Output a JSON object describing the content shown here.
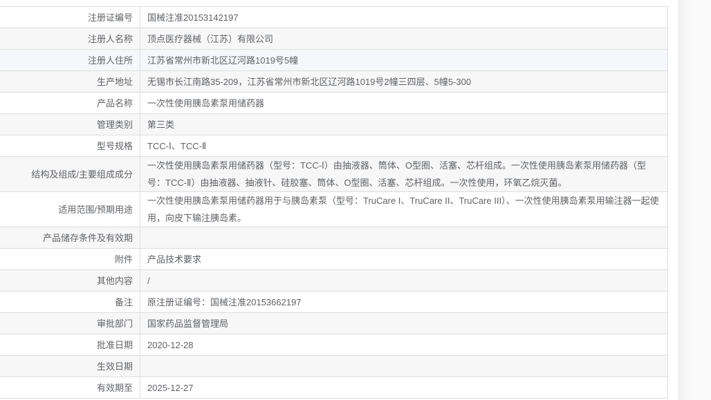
{
  "rows": [
    {
      "label": "注册证编号",
      "value": "国械注准20153142197"
    },
    {
      "label": "注册人名称",
      "value": "顶点医疗器械（江苏）有限公司"
    },
    {
      "label": "注册人住所",
      "value": "江苏省常州市新北区辽河路1019号5幢"
    },
    {
      "label": "生产地址",
      "value": "无锡市长江南路35-209，江苏省常州市新北区辽河路1019号2幢三四层、5幢5-300"
    },
    {
      "label": "产品名称",
      "value": "一次性使用胰岛素泵用储药器"
    },
    {
      "label": "管理类别",
      "value": "第三类"
    },
    {
      "label": "型号规格",
      "value": "TCC-Ⅰ、TCC-Ⅱ"
    },
    {
      "label": "结构及组成/主要组成成分",
      "value": "一次性使用胰岛素泵用储药器（型号：TCC-Ⅰ）由抽液器、筒体、O型圈、活塞、芯杆组成。一次性使用胰岛素泵用储药器（型号：TCC-Ⅱ）由抽液器、抽液针、硅胶塞、筒体、O型圈、活塞、芯杆组成。一次性使用，环氧乙烷灭菌。"
    },
    {
      "label": "适用范围/预期用途",
      "value": "一次性使用胰岛素泵用储药器用于与胰岛素泵（型号：TruCare I、TruCare II、TruCare III）、一次性使用胰岛素泵用输注器一起使用，向皮下输注胰岛素。"
    },
    {
      "label": "产品储存条件及有效期",
      "value": ""
    },
    {
      "label": "附件",
      "value": "产品技术要求"
    },
    {
      "label": "其他内容",
      "value": "/"
    },
    {
      "label": "备注",
      "value": "原注册证编号：国械注准20153662197"
    },
    {
      "label": "审批部门",
      "value": "国家药品监督管理局"
    },
    {
      "label": "批准日期",
      "value": "2020-12-28"
    },
    {
      "label": "生效日期",
      "value": ""
    },
    {
      "label": "有效期至",
      "value": "2025-12-27"
    }
  ]
}
